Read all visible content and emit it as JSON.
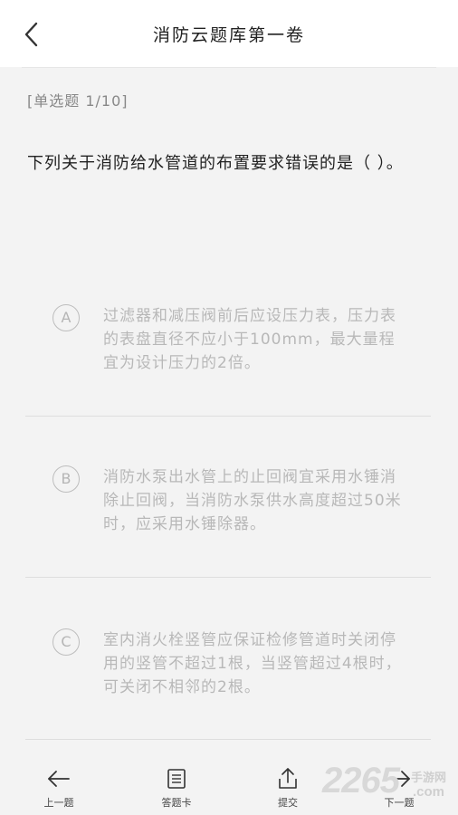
{
  "header": {
    "title": "消防云题库第一卷"
  },
  "question": {
    "type_label": "[单选题 1/10]",
    "text": "下列关于消防给水管道的布置要求错误的是（ ）。"
  },
  "options": [
    {
      "letter": "A",
      "text": "过滤器和减压阀前后应设压力表，压力表的表盘直径不应小于100mm，最大量程宜为设计压力的2倍。"
    },
    {
      "letter": "B",
      "text": "消防水泵出水管上的止回阀宜采用水锤消除止回阀，当消防水泵供水高度超过50米时，应采用水锤除器。"
    },
    {
      "letter": "C",
      "text": "室内消火栓竖管应保证检修管道时关闭停用的竖管不超过1根，当竖管超过4根时，可关闭不相邻的2根。"
    }
  ],
  "bottom_nav": {
    "prev_label": "上一题",
    "card_label": "答题卡",
    "submit_label": "提交",
    "next_label": "下一题"
  },
  "watermark": {
    "number": "2265",
    "cn": "手游网",
    "com": ".com"
  }
}
